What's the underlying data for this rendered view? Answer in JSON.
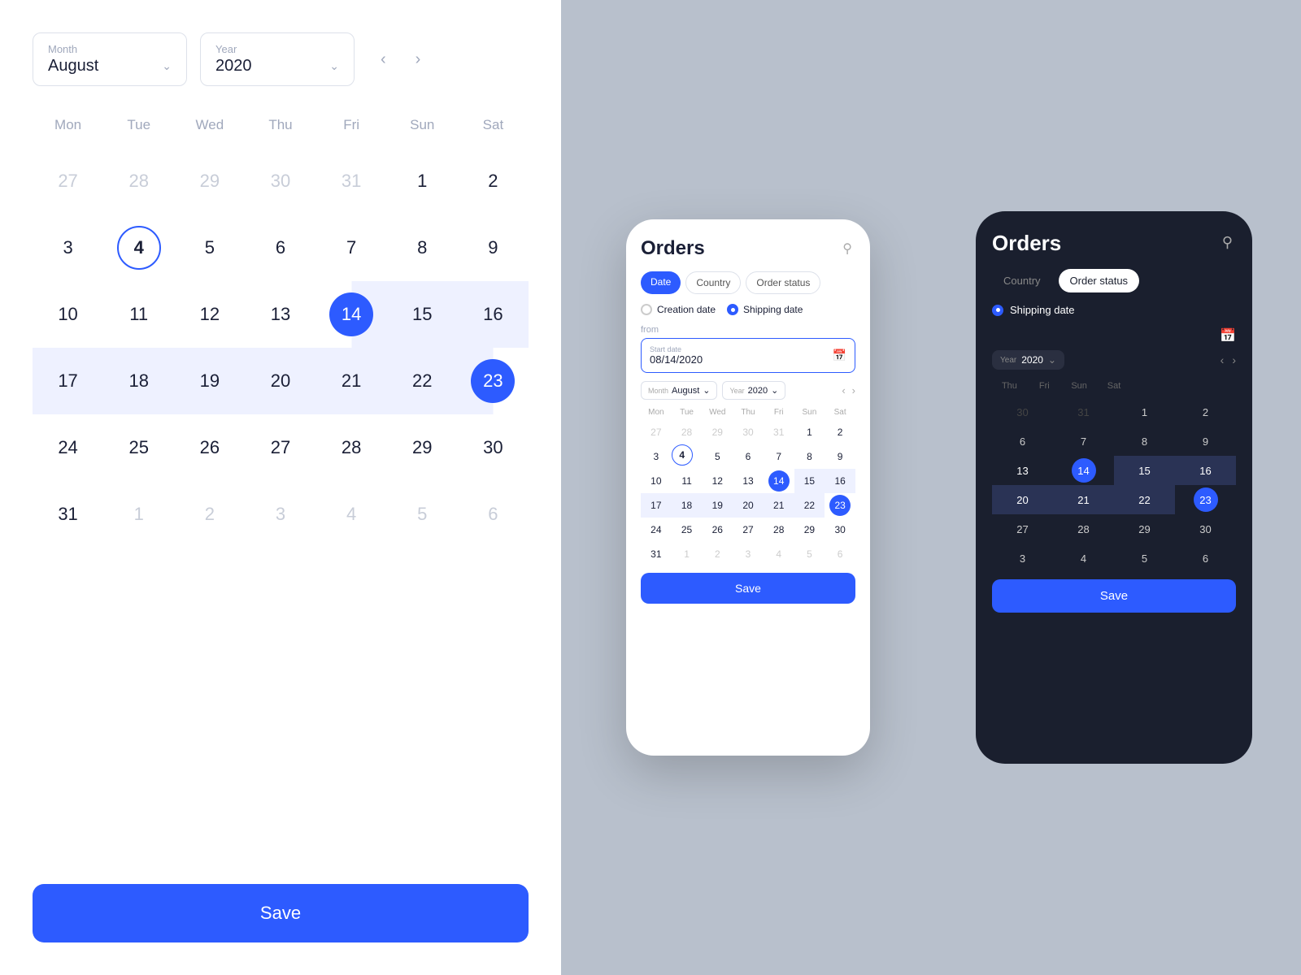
{
  "left": {
    "month_label": "Month",
    "month_value": "August",
    "year_label": "Year",
    "year_value": "2020",
    "weekdays": [
      "Mon",
      "Tue",
      "Wed",
      "Thu",
      "Fri",
      "Sun",
      "Sat"
    ],
    "days": [
      {
        "d": 27,
        "m": "other"
      },
      {
        "d": 28,
        "m": "other"
      },
      {
        "d": 29,
        "m": "other"
      },
      {
        "d": 30,
        "m": "other"
      },
      {
        "d": 31,
        "m": "other"
      },
      {
        "d": 1,
        "m": "cur"
      },
      {
        "d": 2,
        "m": "cur"
      },
      {
        "d": 3,
        "m": "cur"
      },
      {
        "d": 4,
        "m": "cur",
        "today": true
      },
      {
        "d": 5,
        "m": "cur"
      },
      {
        "d": 6,
        "m": "cur"
      },
      {
        "d": 7,
        "m": "cur"
      },
      {
        "d": 8,
        "m": "cur"
      },
      {
        "d": 9,
        "m": "cur"
      },
      {
        "d": 10,
        "m": "cur"
      },
      {
        "d": 11,
        "m": "cur"
      },
      {
        "d": 12,
        "m": "cur"
      },
      {
        "d": 13,
        "m": "cur"
      },
      {
        "d": 14,
        "m": "cur",
        "sel_start": true
      },
      {
        "d": 15,
        "m": "cur",
        "in_range": true
      },
      {
        "d": 16,
        "m": "cur",
        "in_range": true
      },
      {
        "d": 17,
        "m": "cur",
        "in_range": true
      },
      {
        "d": 18,
        "m": "cur",
        "in_range": true
      },
      {
        "d": 19,
        "m": "cur",
        "in_range": true
      },
      {
        "d": 20,
        "m": "cur",
        "in_range": true
      },
      {
        "d": 21,
        "m": "cur",
        "in_range": true
      },
      {
        "d": 22,
        "m": "cur",
        "in_range": true
      },
      {
        "d": 23,
        "m": "cur",
        "sel_end": true
      },
      {
        "d": 24,
        "m": "cur"
      },
      {
        "d": 25,
        "m": "cur"
      },
      {
        "d": 26,
        "m": "cur"
      },
      {
        "d": 27,
        "m": "cur"
      },
      {
        "d": 28,
        "m": "cur"
      },
      {
        "d": 29,
        "m": "cur"
      },
      {
        "d": 30,
        "m": "cur"
      },
      {
        "d": 31,
        "m": "cur"
      },
      {
        "d": 1,
        "m": "other"
      },
      {
        "d": 2,
        "m": "other"
      },
      {
        "d": 3,
        "m": "other"
      },
      {
        "d": 4,
        "m": "other"
      },
      {
        "d": 5,
        "m": "other"
      },
      {
        "d": 6,
        "m": "other"
      }
    ],
    "save_label": "Save"
  },
  "phone_white": {
    "title": "Orders",
    "tabs": [
      "Date",
      "Country",
      "Order status"
    ],
    "active_tab": "Date",
    "radio_options": [
      "Creation date",
      "Shipping date"
    ],
    "active_radio": "Shipping date",
    "from_label": "from",
    "start_date_label": "Start date",
    "start_date_value": "08/14/2020",
    "month_label": "Month",
    "month_value": "August",
    "year_label": "Year",
    "year_value": "2020",
    "weekdays": [
      "Mon",
      "Tue",
      "Wed",
      "Thu",
      "Fri",
      "Sun",
      "Sat"
    ],
    "days": [
      {
        "d": 27,
        "m": "other"
      },
      {
        "d": 28,
        "m": "other"
      },
      {
        "d": 29,
        "m": "other"
      },
      {
        "d": 30,
        "m": "other"
      },
      {
        "d": 31,
        "m": "other"
      },
      {
        "d": 1,
        "m": "cur"
      },
      {
        "d": 2,
        "m": "cur"
      },
      {
        "d": 3,
        "m": "cur"
      },
      {
        "d": 4,
        "m": "cur",
        "today": true
      },
      {
        "d": 5,
        "m": "cur"
      },
      {
        "d": 6,
        "m": "cur"
      },
      {
        "d": 7,
        "m": "cur"
      },
      {
        "d": 8,
        "m": "cur"
      },
      {
        "d": 9,
        "m": "cur"
      },
      {
        "d": 10,
        "m": "cur"
      },
      {
        "d": 11,
        "m": "cur"
      },
      {
        "d": 12,
        "m": "cur"
      },
      {
        "d": 13,
        "m": "cur"
      },
      {
        "d": 14,
        "m": "cur",
        "sel_dot": true
      },
      {
        "d": 15,
        "m": "cur",
        "in_range": true
      },
      {
        "d": 16,
        "m": "cur",
        "in_range": true
      },
      {
        "d": 17,
        "m": "cur",
        "in_range": true
      },
      {
        "d": 18,
        "m": "cur",
        "in_range": true
      },
      {
        "d": 19,
        "m": "cur",
        "in_range": true
      },
      {
        "d": 20,
        "m": "cur",
        "in_range": true
      },
      {
        "d": 21,
        "m": "cur",
        "in_range": true
      },
      {
        "d": 22,
        "m": "cur",
        "in_range": true
      },
      {
        "d": 23,
        "m": "cur",
        "sel_dot": true
      },
      {
        "d": 24,
        "m": "cur"
      },
      {
        "d": 25,
        "m": "cur"
      },
      {
        "d": 26,
        "m": "cur"
      },
      {
        "d": 27,
        "m": "cur"
      },
      {
        "d": 28,
        "m": "cur"
      },
      {
        "d": 29,
        "m": "cur"
      },
      {
        "d": 30,
        "m": "cur"
      },
      {
        "d": 31,
        "m": "cur"
      },
      {
        "d": 1,
        "m": "other"
      },
      {
        "d": 2,
        "m": "other"
      },
      {
        "d": 3,
        "m": "other"
      },
      {
        "d": 4,
        "m": "other"
      },
      {
        "d": 5,
        "m": "other"
      },
      {
        "d": 6,
        "m": "other"
      }
    ],
    "save_label": "Save"
  },
  "phone_dark": {
    "title": "Orders",
    "tabs": [
      "Country",
      "Order status"
    ],
    "active_tab": "Order status",
    "radio_label": "Shipping date",
    "year_label": "Year",
    "year_value": "2020",
    "weekdays": [
      "Thu",
      "Fri",
      "Sun",
      "Sat"
    ],
    "weekdays_full": [
      "Thu",
      "Fri",
      "Sun",
      "Sat"
    ],
    "save_label": "Save"
  },
  "accent_color": "#2d5bff",
  "bg_color": "#b8c0cc"
}
